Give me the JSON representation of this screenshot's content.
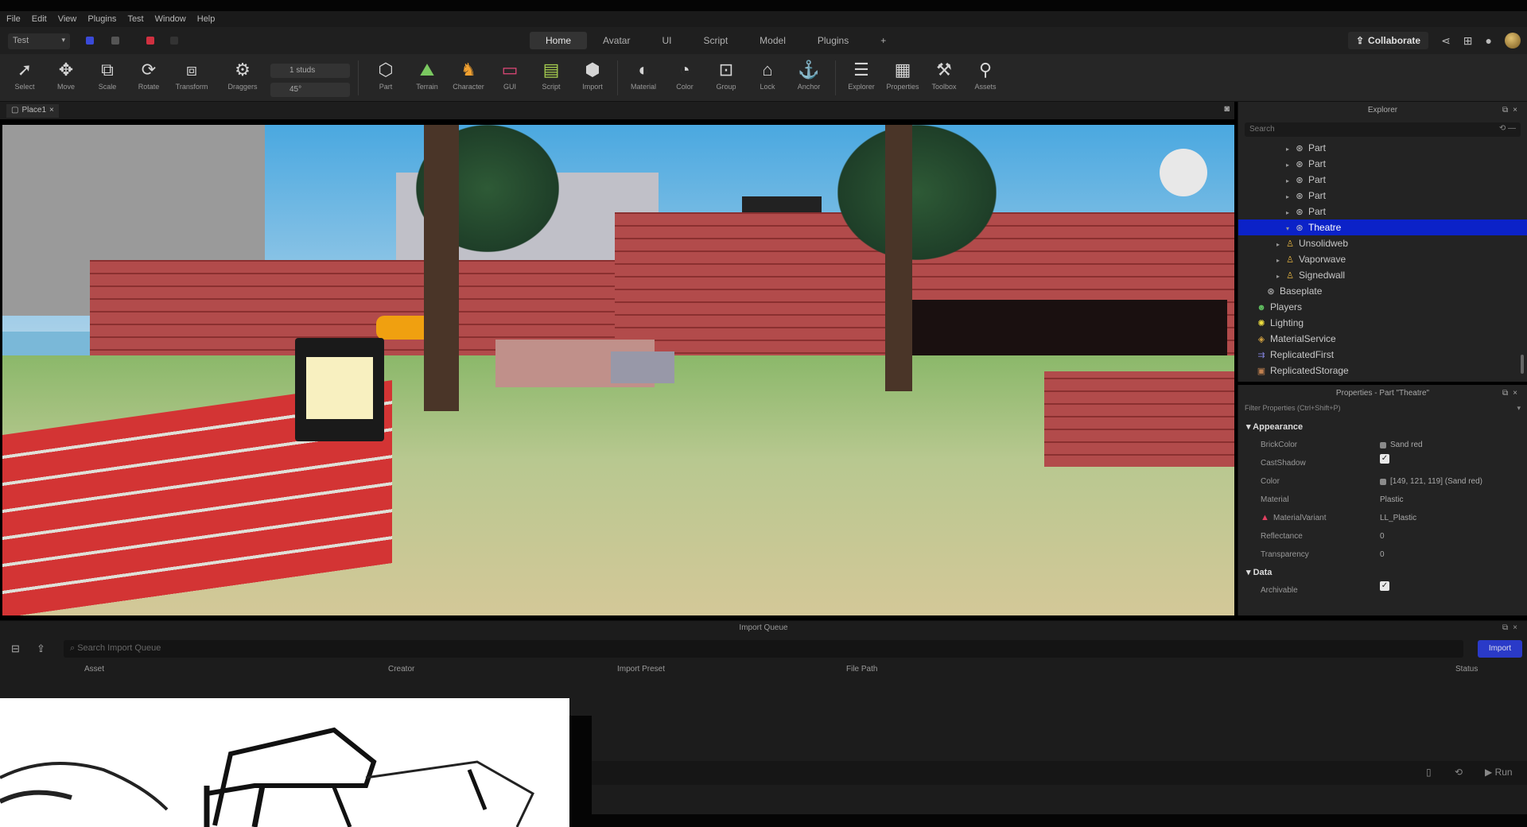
{
  "menu": [
    "File",
    "Edit",
    "View",
    "Plugins",
    "Test",
    "Window",
    "Help"
  ],
  "mode_select": "Test",
  "ribbon_tabs": [
    "Home",
    "Avatar",
    "UI",
    "Script",
    "Model",
    "Plugins"
  ],
  "add_tab": "+",
  "collaborate": "Collaborate",
  "tools": {
    "select": "Select",
    "move": "Move",
    "scale": "Scale",
    "rotate": "Rotate",
    "transform": "Transform",
    "dragger": "Draggers",
    "part": "Part",
    "terrain": "Terrain",
    "character": "Character",
    "gui": "GUI",
    "script": "Script",
    "import": "Import",
    "material": "Material",
    "color": "Color",
    "group": "Group",
    "lock": "Lock",
    "anchor": "Anchor",
    "explorer": "Explorer",
    "properties": "Properties",
    "toolbox": "Toolbox",
    "assets": "Assets"
  },
  "move_step": "1 studs",
  "rotate_step": "45°",
  "doc_tab": "Place1",
  "explorer": {
    "title": "Explorer",
    "search_placeholder": "Search",
    "items": [
      {
        "label": "Part",
        "indent": 5,
        "icon": "part",
        "arrow": "▸"
      },
      {
        "label": "Part",
        "indent": 5,
        "icon": "part",
        "arrow": "▸"
      },
      {
        "label": "Part",
        "indent": 5,
        "icon": "part",
        "arrow": "▸"
      },
      {
        "label": "Part",
        "indent": 5,
        "icon": "part",
        "arrow": "▸"
      },
      {
        "label": "Part",
        "indent": 5,
        "icon": "part",
        "arrow": "▸"
      },
      {
        "label": "Theatre",
        "indent": 5,
        "icon": "part",
        "arrow": "▾",
        "selected": true
      },
      {
        "label": "Unsolidweb",
        "indent": 4,
        "icon": "npc",
        "arrow": "▸"
      },
      {
        "label": "Vaporwave",
        "indent": 4,
        "icon": "npc",
        "arrow": "▸"
      },
      {
        "label": "Signedwall",
        "indent": 4,
        "icon": "npc",
        "arrow": "▸"
      },
      {
        "label": "Baseplate",
        "indent": 2,
        "icon": "part",
        "arrow": ""
      },
      {
        "label": "Players",
        "indent": 1,
        "icon": "players",
        "arrow": ""
      },
      {
        "label": "Lighting",
        "indent": 1,
        "icon": "light",
        "arrow": ""
      },
      {
        "label": "MaterialService",
        "indent": 1,
        "icon": "material",
        "arrow": ""
      },
      {
        "label": "ReplicatedFirst",
        "indent": 1,
        "icon": "replicated",
        "arrow": ""
      },
      {
        "label": "ReplicatedStorage",
        "indent": 1,
        "icon": "storage",
        "arrow": ""
      }
    ]
  },
  "properties": {
    "title": "Properties - Part \"Theatre\"",
    "filter": "Filter Properties (Ctrl+Shift+P)",
    "sections": [
      {
        "name": "Appearance",
        "rows": [
          {
            "name": "BrickColor",
            "value": "Sand red",
            "swatch": true
          },
          {
            "name": "CastShadow",
            "value": "",
            "check": true
          },
          {
            "name": "Color",
            "value": "[149, 121, 119] (Sand red)",
            "swatch": true
          },
          {
            "name": "Material",
            "value": "Plastic"
          },
          {
            "name": "MaterialVariant",
            "value": "LL_Plastic",
            "warn": true
          },
          {
            "name": "Reflectance",
            "value": "0"
          },
          {
            "name": "Transparency",
            "value": "0"
          }
        ]
      },
      {
        "name": "Data",
        "rows": [
          {
            "name": "Archivable",
            "value": "",
            "check": true
          }
        ]
      }
    ]
  },
  "import_queue": {
    "title": "Import Queue",
    "search_placeholder": "Search Import Queue",
    "import_button": "Import",
    "columns": [
      "Asset",
      "Creator",
      "Import Preset",
      "File Path",
      "Status"
    ],
    "run_label": "Run"
  },
  "colors": {
    "selection": "#0b22c8",
    "accent_button": "#2a3ac8",
    "brick_red": "#d33434"
  }
}
